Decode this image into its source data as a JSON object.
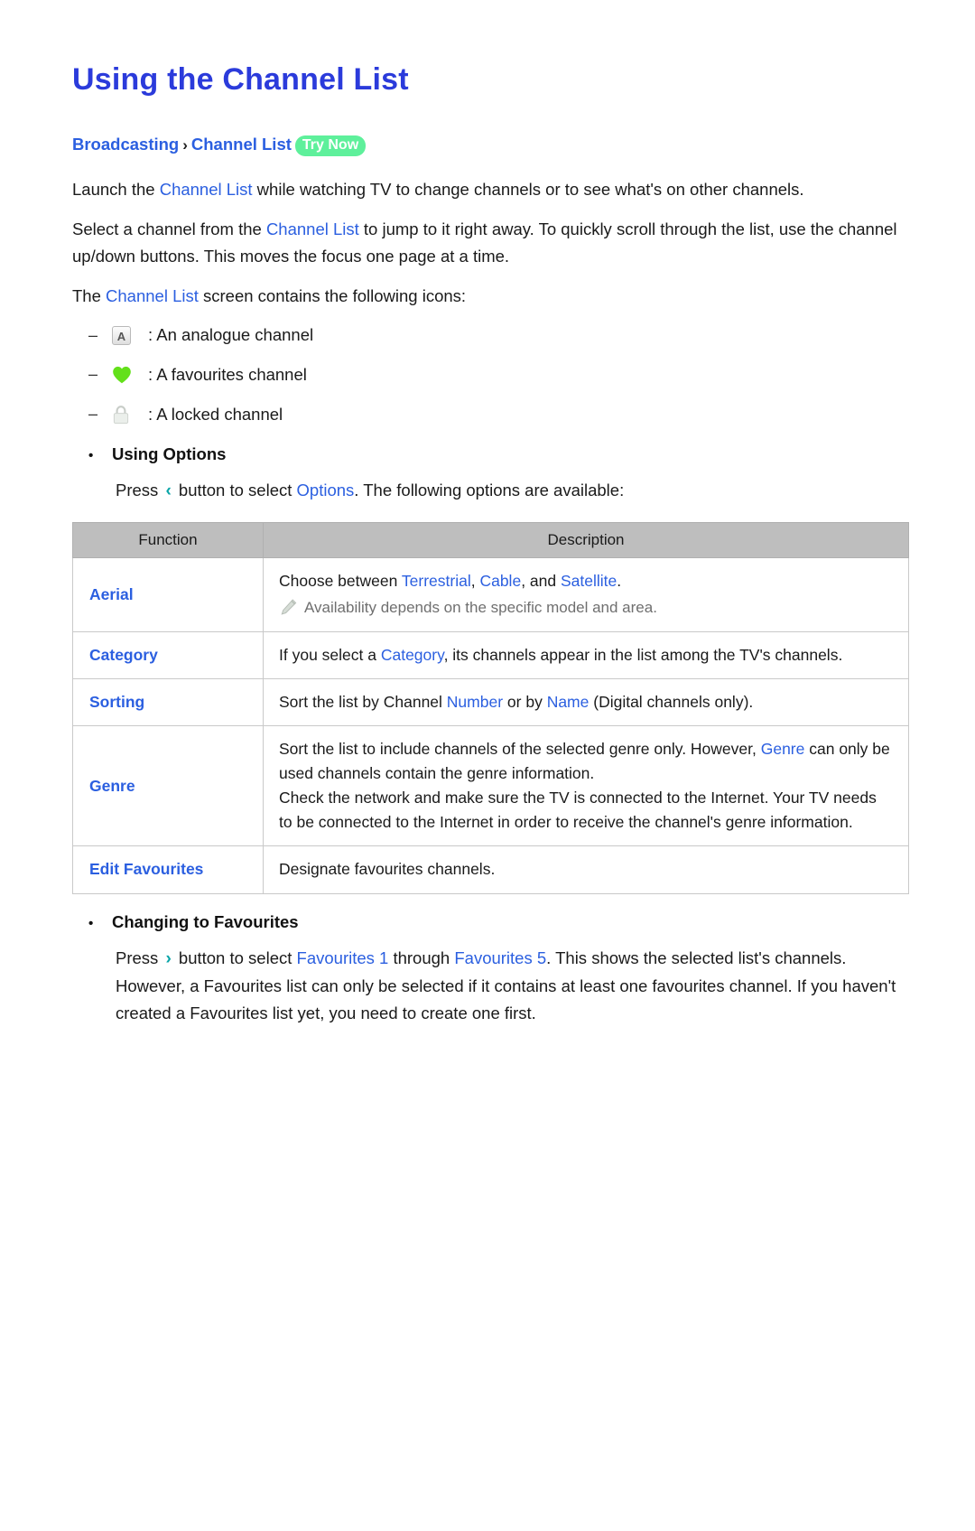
{
  "document": {
    "title": "Using the Channel List",
    "breadcrumb": {
      "first": "Broadcasting",
      "separator": "›",
      "second": "Channel List",
      "badge": "Try Now"
    },
    "paragraphs": {
      "p1_a": "Launch the ",
      "p1_kw": "Channel List",
      "p1_b": " while watching TV to change channels or to see what's on other channels.",
      "p2_a": "Select a channel from the ",
      "p2_kw": "Channel List",
      "p2_b": " to jump to it right away. To quickly scroll through the list, use the channel up/down buttons. This moves the focus one page at a time.",
      "p3_a": "The ",
      "p3_kw": "Channel List",
      "p3_b": " screen contains the following icons:"
    },
    "icon_list": [
      {
        "icon": "analogue-a-icon",
        "glyph": "A",
        "text": ": An analogue channel"
      },
      {
        "icon": "favourites-heart-icon",
        "glyph": "♥",
        "text": ": A favourites channel"
      },
      {
        "icon": "locked-padlock-icon",
        "glyph": "🔒",
        "text": ": A locked channel"
      }
    ],
    "using_options": {
      "bullet": "•",
      "heading": "Using Options",
      "line_a": "Press ",
      "arrow": "‹",
      "line_b": " button to select ",
      "keyword": "Options",
      "line_c": ". The following options are available:"
    },
    "table": {
      "headers": [
        "Function",
        "Description"
      ],
      "rows": [
        {
          "function": "Aerial",
          "desc_a": "Choose between ",
          "kw1": "Terrestrial",
          "desc_b": ", ",
          "kw2": "Cable",
          "desc_c": ", and ",
          "kw3": "Satellite",
          "desc_d": ".",
          "note_icon": "pencil-note-icon",
          "note": "Availability depends on the specific model and area."
        },
        {
          "function": "Category",
          "desc_a": "If you select a ",
          "kw1": "Category",
          "desc_b": ", its channels appear in the list among the TV's channels."
        },
        {
          "function": "Sorting",
          "desc_a": "Sort the list by Channel ",
          "kw1": "Number",
          "desc_b": " or by ",
          "kw2": "Name",
          "desc_c": " (Digital channels only)."
        },
        {
          "function": "Genre",
          "desc_a": "Sort the list to include channels of the selected genre only. However, ",
          "kw1": "Genre",
          "desc_b": " can only be used channels contain the genre information.",
          "desc_c": "Check the network and make sure the TV is connected to the Internet. Your TV needs to be connected to the Internet in order to receive the channel's genre information."
        },
        {
          "function": "Edit Favourites",
          "desc_a": "Designate favourites channels."
        }
      ]
    },
    "changing_favourites": {
      "bullet": "•",
      "heading": "Changing to Favourites",
      "line_a": "Press ",
      "arrow": "›",
      "line_b": " button to select ",
      "kw1": "Favourites 1",
      "line_c": " through ",
      "kw2": "Favourites 5",
      "line_d": ". This shows the selected list's channels. However, a Favourites list can only be selected if it contains at least one favourites channel. If you haven't created a Favourites list yet, you need to create one first."
    }
  },
  "colors": {
    "title_blue": "#2b3bdb",
    "link_blue": "#2b5fe0",
    "badge_green": "#5ef09b",
    "arrow_teal": "#0aa5a8",
    "table_header_gray": "#bebebe",
    "heart_green": "#63e01a",
    "note_gray": "#6f6f6f"
  }
}
